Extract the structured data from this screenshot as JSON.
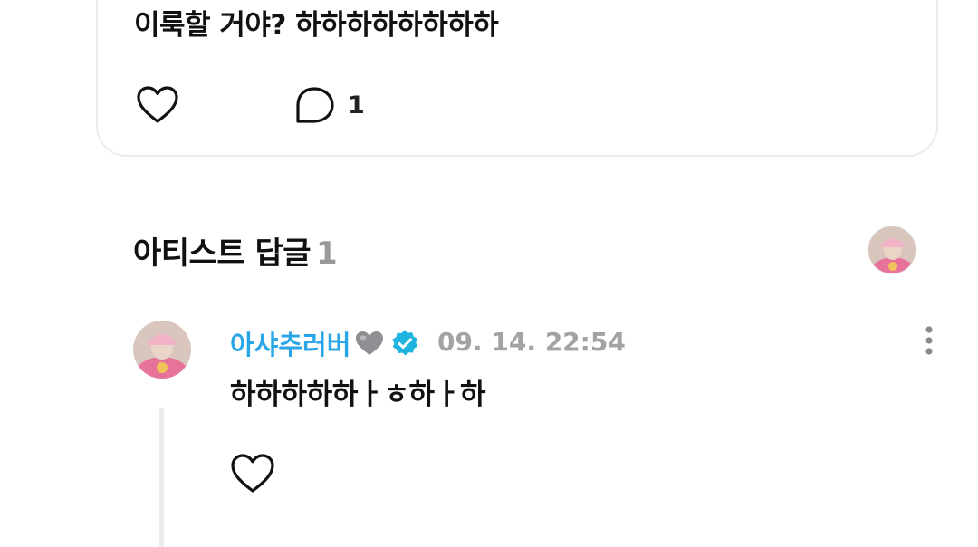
{
  "post": {
    "text": "이룩할 거야? 하하하하하하하하",
    "comment_count": "1",
    "icons": {
      "like": "heart-outline-icon",
      "comment": "speech-bubble-icon"
    }
  },
  "artist_replies": {
    "title": "아티스트 답글",
    "count": "1"
  },
  "reply": {
    "author": "아샤추러버",
    "author_emoji": "grey-heart-icon",
    "verified": "verified-badge-icon",
    "date": "09. 14. 22:54",
    "text": "하하하하하ㅏㅎ하ㅏ하"
  },
  "colors": {
    "accent": "#2aa6e8",
    "muted": "#a3a3a3",
    "verified": "#1fb4e0",
    "avatar_pink": "#e8739a"
  }
}
